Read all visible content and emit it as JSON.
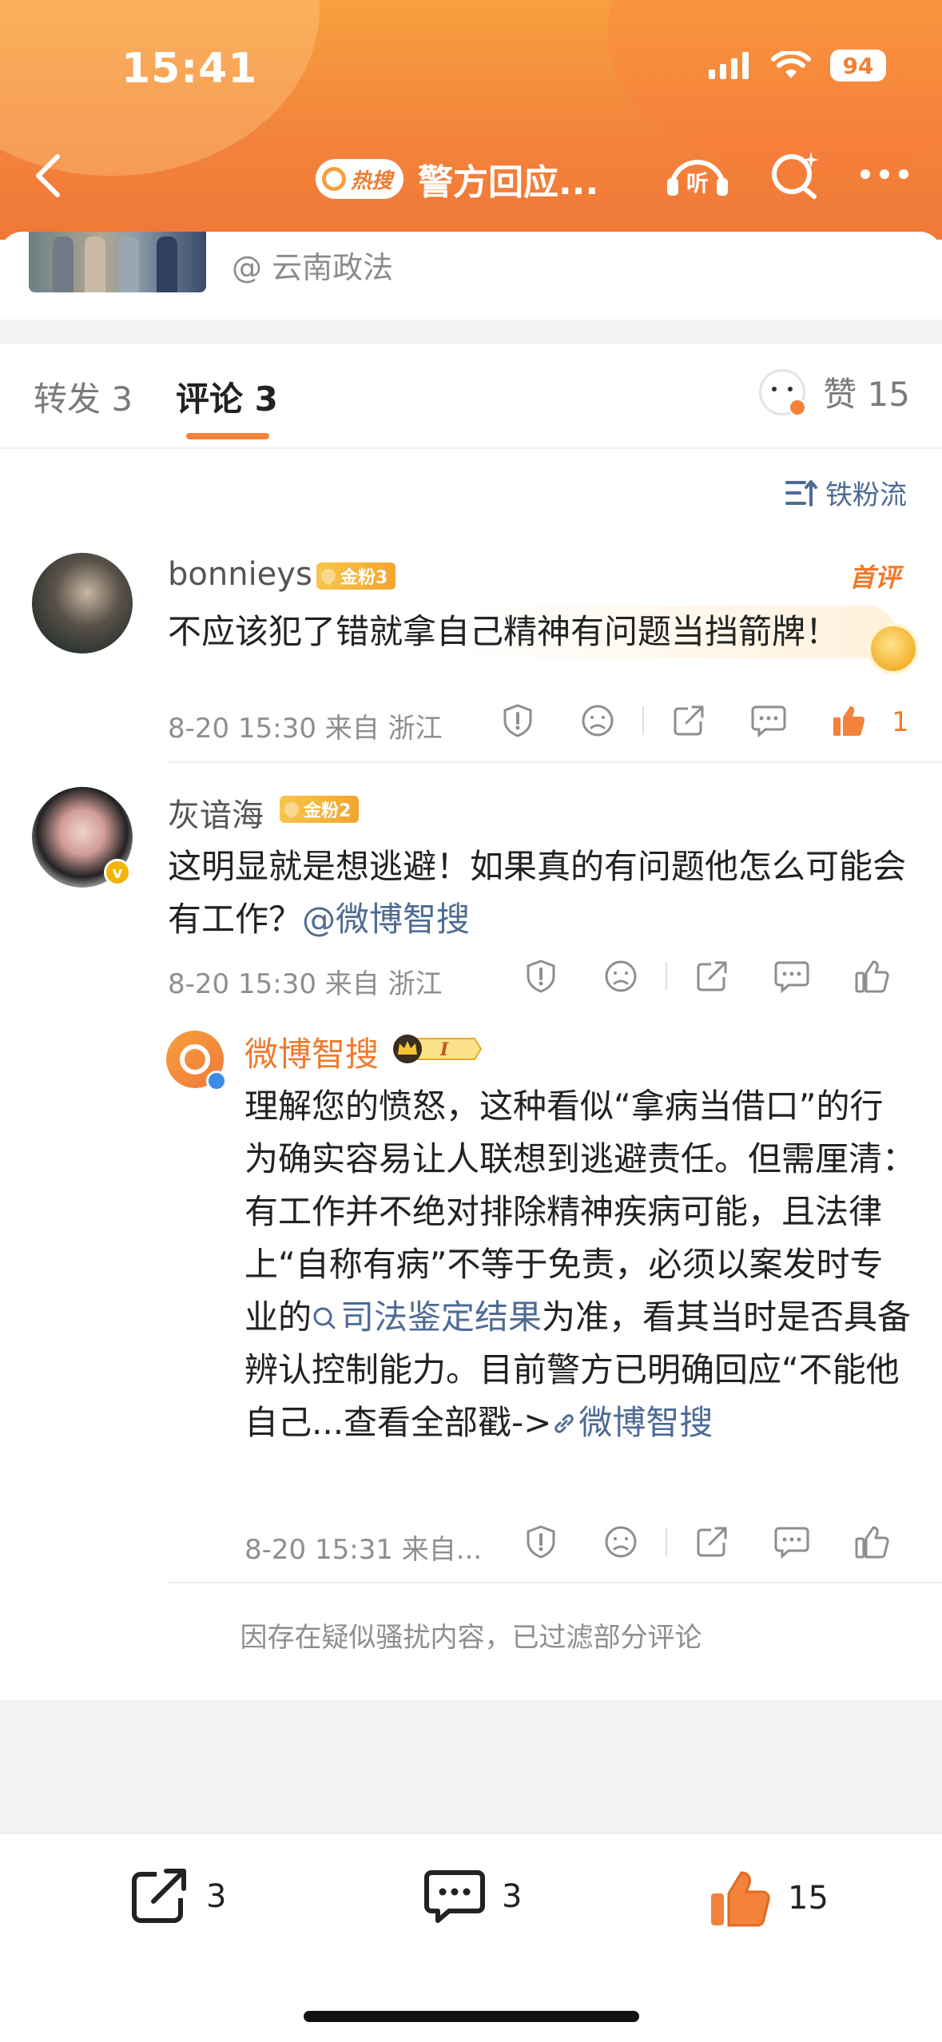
{
  "status_bar": {
    "time": "15:41",
    "battery": "94"
  },
  "nav": {
    "hot_badge": "热搜",
    "title": "警方回应..."
  },
  "post": {
    "source": "@ 云南政法"
  },
  "tabs": {
    "repost": "转发 3",
    "comment": "评论 3",
    "like": "赞 15"
  },
  "sort": {
    "label": "铁粉流"
  },
  "comments": [
    {
      "username": "bonnieys",
      "fan_badge": "金粉3",
      "tag": "首评",
      "text": "不应该犯了错就拿自己精神有问题当挡箭牌！",
      "meta": "8-20 15:30  来自 浙江",
      "likes": "1"
    },
    {
      "username": "灰谙海",
      "fan_badge": "金粉2",
      "text": "这明显就是想逃避！如果真的有问题他怎么可能会有工作？",
      "mention": "@微博智搜",
      "meta": "8-20 15:30  来自 浙江"
    }
  ],
  "reply": {
    "username": "微博智搜",
    "badge": "I",
    "text_part1": "理解您的愤怒，这种看似“拿病当借口”的行为确实容易让人联想到逃避责任。但需厘清：有工作并不绝对排除精神疾病可能，且法律上“自称有病”不等于免责，必须以案发时专业的",
    "search_link": "司法鉴定结果",
    "text_part2": "为准，看其当时是否具备辨认控制能力。目前警方已明确回应“不能他自己...查看全部戳->",
    "link": "微博智搜",
    "meta": "8-20 15:31  来自..."
  },
  "filter_note": "因存在疑似骚扰内容，已过滤部分评论",
  "bottom_bar": {
    "repost_count": "3",
    "comment_count": "3",
    "like_count": "15"
  },
  "colors": {
    "accent": "#f3823c",
    "link": "#4e6b95",
    "header_top": "#f7a03f",
    "header_bottom": "#f07837"
  }
}
